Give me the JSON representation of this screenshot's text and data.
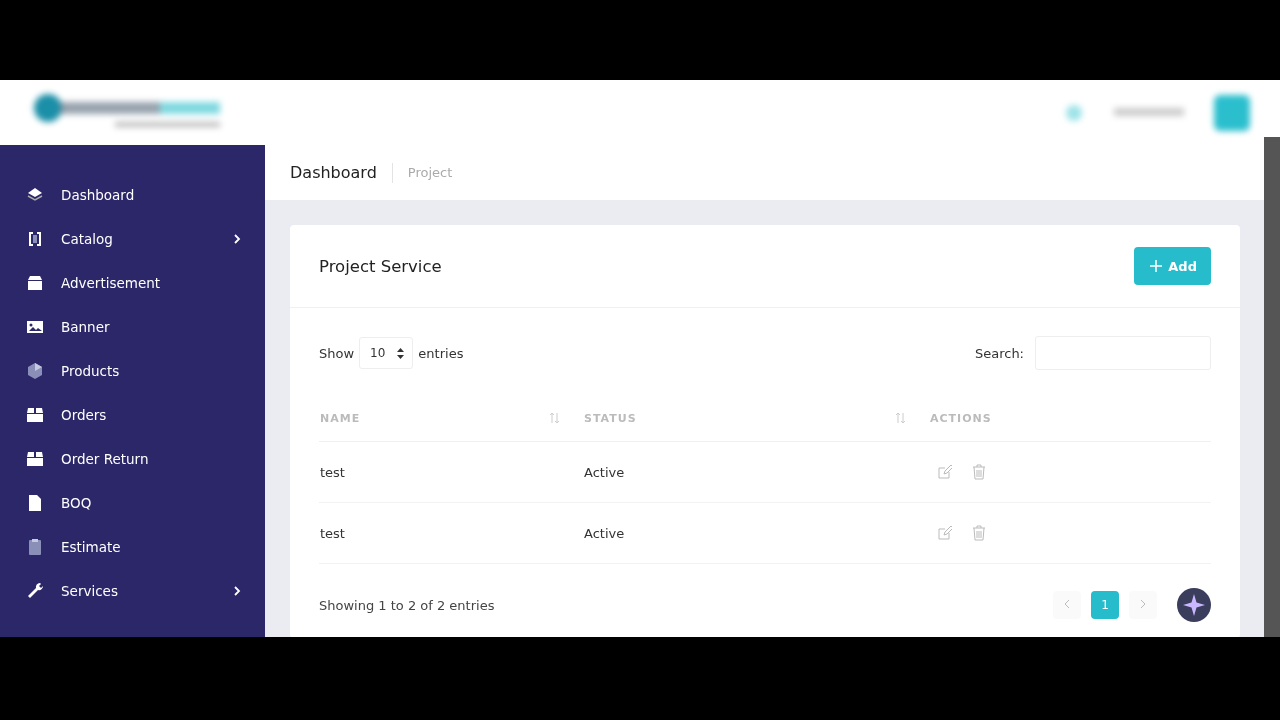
{
  "breadcrumb": {
    "title": "Dashboard",
    "current": "Project"
  },
  "sidebar": {
    "items": [
      {
        "label": "Dashboard",
        "expandable": false
      },
      {
        "label": "Catalog",
        "expandable": true
      },
      {
        "label": "Advertisement",
        "expandable": false
      },
      {
        "label": "Banner",
        "expandable": false
      },
      {
        "label": "Products",
        "expandable": false
      },
      {
        "label": "Orders",
        "expandable": false
      },
      {
        "label": "Order Return",
        "expandable": false
      },
      {
        "label": "BOQ",
        "expandable": false
      },
      {
        "label": "Estimate",
        "expandable": false
      },
      {
        "label": "Services",
        "expandable": true
      }
    ]
  },
  "card": {
    "title": "Project Service",
    "add_button": "Add"
  },
  "table_controls": {
    "show_label": "Show",
    "page_size": "10",
    "entries_label": "entries",
    "search_label": "Search:"
  },
  "table": {
    "columns": [
      {
        "label": "NAME",
        "sortable": true
      },
      {
        "label": "STATUS",
        "sortable": true
      },
      {
        "label": "ACTIONS",
        "sortable": false
      }
    ],
    "rows": [
      {
        "name": "test",
        "status": "Active"
      },
      {
        "name": "test",
        "status": "Active"
      }
    ]
  },
  "footer_info": "Showing 1 to 2 of 2 entries",
  "pagination": {
    "pages": [
      {
        "label": "1",
        "selected": true
      }
    ]
  }
}
